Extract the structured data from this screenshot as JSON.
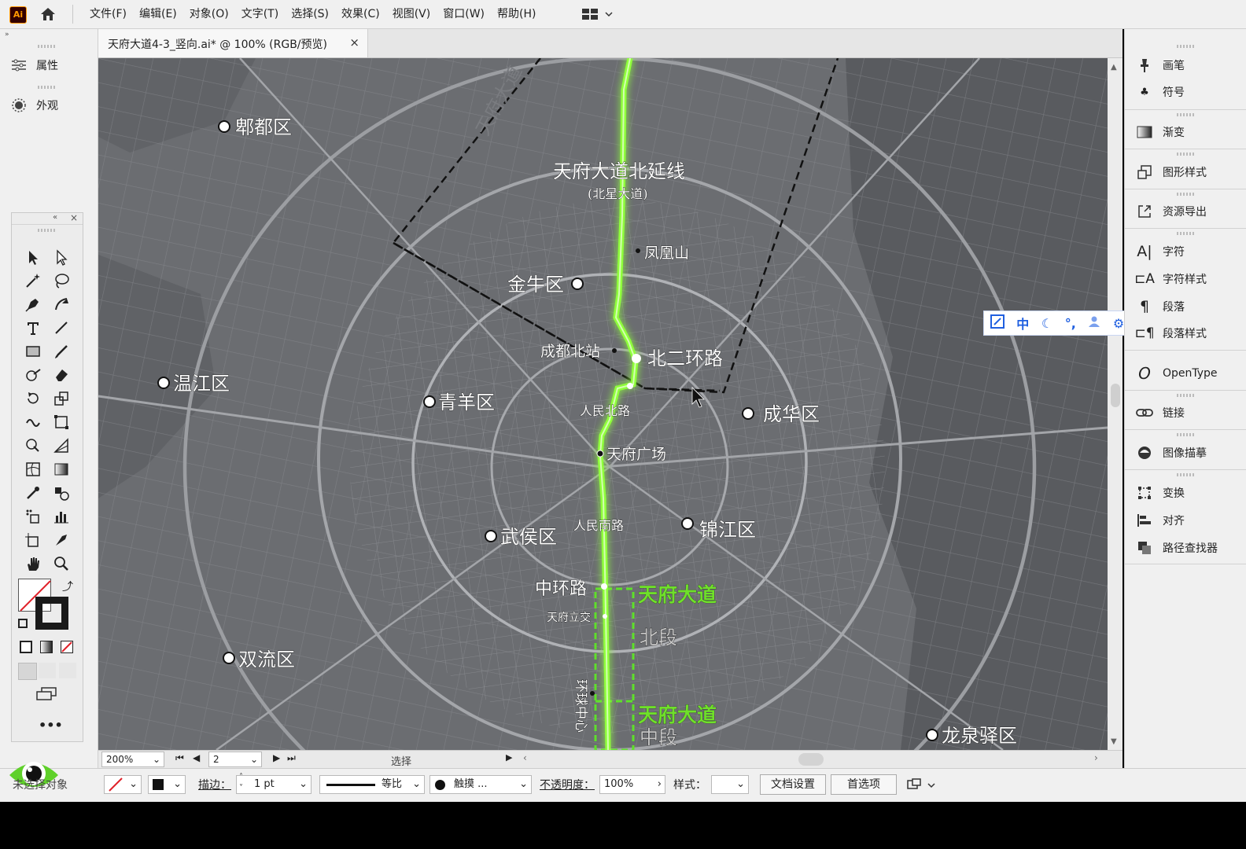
{
  "menubar": {
    "logo": "Ai",
    "menus": [
      "文件(F)",
      "编辑(E)",
      "对象(O)",
      "文字(T)",
      "选择(S)",
      "效果(C)",
      "视图(V)",
      "窗口(W)",
      "帮助(H)"
    ]
  },
  "left_panels": {
    "properties": "属性",
    "appearance": "外观"
  },
  "document": {
    "tab_title": "天府大道4-3_竖向.ai* @ 100% (RGB/预览)",
    "close": "×"
  },
  "map": {
    "places": {
      "pixian": "郫都区",
      "jinniu": "金牛区",
      "wenjiang": "温江区",
      "qingyang": "青羊区",
      "chenghua": "成华区",
      "wuhou": "武侯区",
      "jinjiang": "锦江区",
      "shuangliu": "双流区",
      "longquanyi": "龙泉驿区",
      "fenghuangshan": "凤凰山",
      "chengdu_north": "成都北站",
      "north2ring": "北二环路",
      "renmin_north": "人民北路",
      "tianfu_square": "天府广场",
      "renmin_south": "人民南路",
      "middle_ring": "中环路",
      "tianfu_interchange": "天府立交",
      "global_center": "环球中心",
      "north_ext": "天府大道北延线",
      "north_ext_sub": "(北星大道)",
      "diag_label": "天府大道",
      "tianfu_a": "天府大道",
      "north_sec": "北段",
      "tianfu_b": "天府大道",
      "mid_sec": "中段"
    }
  },
  "statusbar": {
    "zoom": "200%",
    "artboard": "2",
    "tool": "选择"
  },
  "right_panels": [
    "画笔",
    "符号",
    "渐变",
    "图形样式",
    "资源导出",
    "字符",
    "字符样式",
    "段落",
    "段落样式",
    "OpenType",
    "链接",
    "图像描摹",
    "变换",
    "对齐",
    "路径查找器"
  ],
  "ime_toolbar": [
    "中"
  ],
  "control_bar": {
    "selection": "未选择对象",
    "stroke_label": "描边：",
    "stroke_value": "1 pt",
    "profile": "等比",
    "brush": "触摸 ...",
    "opacity_label": "不透明度：",
    "opacity_value": "100%",
    "style_label": "样式：",
    "doc_setup": "文档设置",
    "preferences": "首选项"
  },
  "colors": {
    "route_green": "#8fff3a",
    "label_green": "#6fe02a",
    "map_bg": "#6d6f73"
  }
}
